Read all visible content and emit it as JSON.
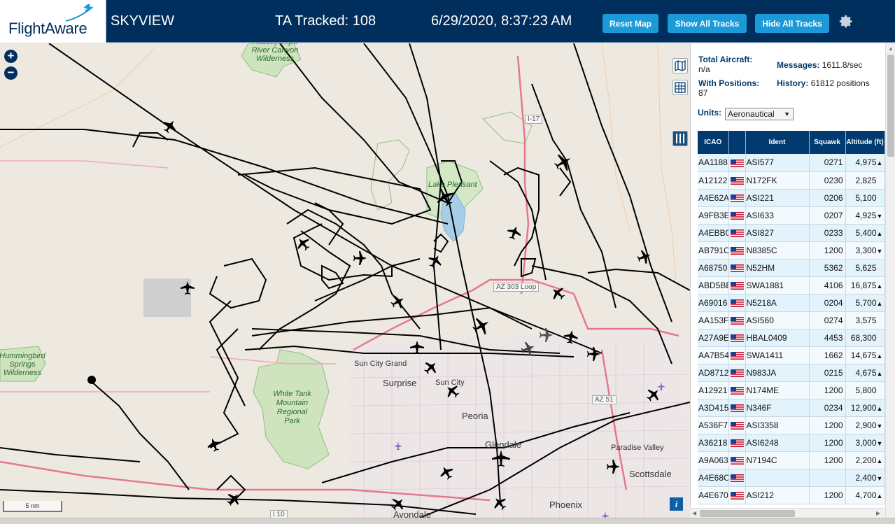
{
  "header": {
    "logo_text": "FlightAware",
    "app_title": "SKYVIEW",
    "tracked": "TA Tracked: 108",
    "datetime": "6/29/2020, 8:37:23 AM",
    "reset_label": "Reset Map",
    "show_label": "Show All Tracks",
    "hide_label": "Hide All Tracks",
    "settings_icon": "gear-icon"
  },
  "map": {
    "zoom_in": "+",
    "zoom_out": "−",
    "scale": "5 nm",
    "info": "i",
    "labels": {
      "hassayampa": "Hassayampa River Canyon Wilderness",
      "lake_pleasant": "Lake Pleasant",
      "hummingbird": "Hummingbird Springs Wilderness",
      "white_tank": "White Tank Mountain Regional Park",
      "sun_city_grand": "Sun City Grand",
      "surprise": "Surprise",
      "sun_city": "Sun City",
      "peoria": "Peoria",
      "glendale": "Glendale",
      "paradise_valley": "Paradise Valley",
      "scottsdale": "Scottsdale",
      "phoenix": "Phoenix",
      "avondale": "Avondale",
      "i17": "I-17",
      "az303": "AZ 303 Loop",
      "az51": "AZ 51",
      "i10": "I 10"
    }
  },
  "stats": {
    "total_label": "Total Aircraft:",
    "total_value": "n/a",
    "messages_label": "Messages:",
    "messages_value": "1611.8/sec",
    "positions_label": "With Positions:",
    "positions_value": "87",
    "history_label": "History:",
    "history_value": "61812 positions",
    "units_label": "Units:",
    "units_value": "Aeronautical"
  },
  "table": {
    "headers": [
      "ICAO",
      "",
      "Ident",
      "Squawk",
      "Altitude (ft)"
    ],
    "rows": [
      {
        "icao": "AA1188",
        "ident": "ASI577",
        "squawk": "0271",
        "alt": "4,975",
        "trend": "▲"
      },
      {
        "icao": "A12122",
        "ident": "N172FK",
        "squawk": "0230",
        "alt": "2,825",
        "trend": ""
      },
      {
        "icao": "A4E62A",
        "ident": "ASI221",
        "squawk": "0206",
        "alt": "5,100",
        "trend": ""
      },
      {
        "icao": "A9FB3E",
        "ident": "ASI633",
        "squawk": "0207",
        "alt": "4,925",
        "trend": "▼"
      },
      {
        "icao": "A4EBB0",
        "ident": "ASI827",
        "squawk": "0233",
        "alt": "5,400",
        "trend": "▲"
      },
      {
        "icao": "AB791C",
        "ident": "N8385C",
        "squawk": "1200",
        "alt": "3,300",
        "trend": "▼"
      },
      {
        "icao": "A68750",
        "ident": "N52HM",
        "squawk": "5362",
        "alt": "5,625",
        "trend": ""
      },
      {
        "icao": "ABD5BB",
        "ident": "SWA1881",
        "squawk": "4106",
        "alt": "16,875",
        "trend": "▲"
      },
      {
        "icao": "A69016",
        "ident": "N5218A",
        "squawk": "0204",
        "alt": "5,700",
        "trend": "▲"
      },
      {
        "icao": "AA153F",
        "ident": "ASI560",
        "squawk": "0274",
        "alt": "3,575",
        "trend": ""
      },
      {
        "icao": "A27A9E",
        "ident": "HBAL0409",
        "squawk": "4453",
        "alt": "68,300",
        "trend": ""
      },
      {
        "icao": "AA7B54",
        "ident": "SWA1411",
        "squawk": "1662",
        "alt": "14,675",
        "trend": "▲"
      },
      {
        "icao": "AD8712",
        "ident": "N983JA",
        "squawk": "0215",
        "alt": "4,675",
        "trend": "▲"
      },
      {
        "icao": "A12921",
        "ident": "N174ME",
        "squawk": "1200",
        "alt": "5,800",
        "trend": ""
      },
      {
        "icao": "A3D415",
        "ident": "N346F",
        "squawk": "0234",
        "alt": "12,900",
        "trend": "▲"
      },
      {
        "icao": "A536F7",
        "ident": "ASI3358",
        "squawk": "1200",
        "alt": "2,900",
        "trend": "▼"
      },
      {
        "icao": "A36218",
        "ident": "ASI6248",
        "squawk": "1200",
        "alt": "3,000",
        "trend": "▼"
      },
      {
        "icao": "A9A063",
        "ident": "N7194C",
        "squawk": "1200",
        "alt": "2,200",
        "trend": "▲"
      },
      {
        "icao": "A4E68C",
        "ident": "",
        "squawk": "",
        "alt": "2,400",
        "trend": "▼"
      },
      {
        "icao": "A4E670",
        "ident": "ASI212",
        "squawk": "1200",
        "alt": "4,700",
        "trend": "▲"
      }
    ]
  },
  "colors": {
    "header_bg": "#002f5d",
    "button_bg": "#1a9ad8",
    "table_header_bg": "#003a6e",
    "row_odd": "#e3f3fb",
    "row_even": "#f3fafd"
  }
}
